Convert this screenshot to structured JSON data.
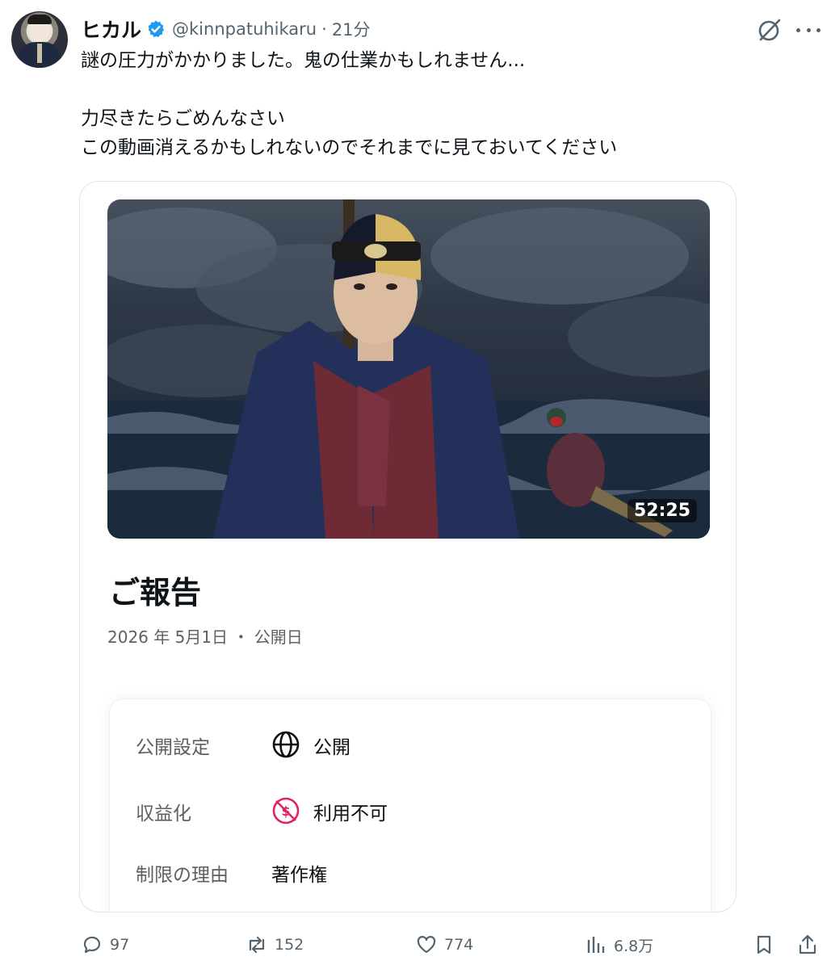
{
  "post": {
    "author_name": "ヒカル",
    "handle": "@kinnpatuhikaru",
    "separator": "·",
    "time": "21分",
    "lines": [
      "謎の圧力がかかりました。鬼の仕業かもしれません...",
      "力尽きたらごめんなさい",
      "この動画消えるかもしれないのでそれまでに見ておいてください"
    ]
  },
  "video": {
    "duration": "52:25",
    "title": "ご報告",
    "date_line": "2026 年 5月1日 ・ 公開日",
    "details": [
      {
        "label": "公開設定",
        "value": "公開",
        "icon": "globe-icon"
      },
      {
        "label": "収益化",
        "value": "利用不可",
        "icon": "no-monetization-icon"
      },
      {
        "label": "制限の理由",
        "value": "著作権",
        "icon": ""
      }
    ]
  },
  "actions": {
    "replies": "97",
    "reposts": "152",
    "likes": "774",
    "views": "6.8万"
  },
  "colors": {
    "verified_blue": "#1d9bf0",
    "muted_text": "#536471",
    "danger_red": "#e0245e"
  }
}
